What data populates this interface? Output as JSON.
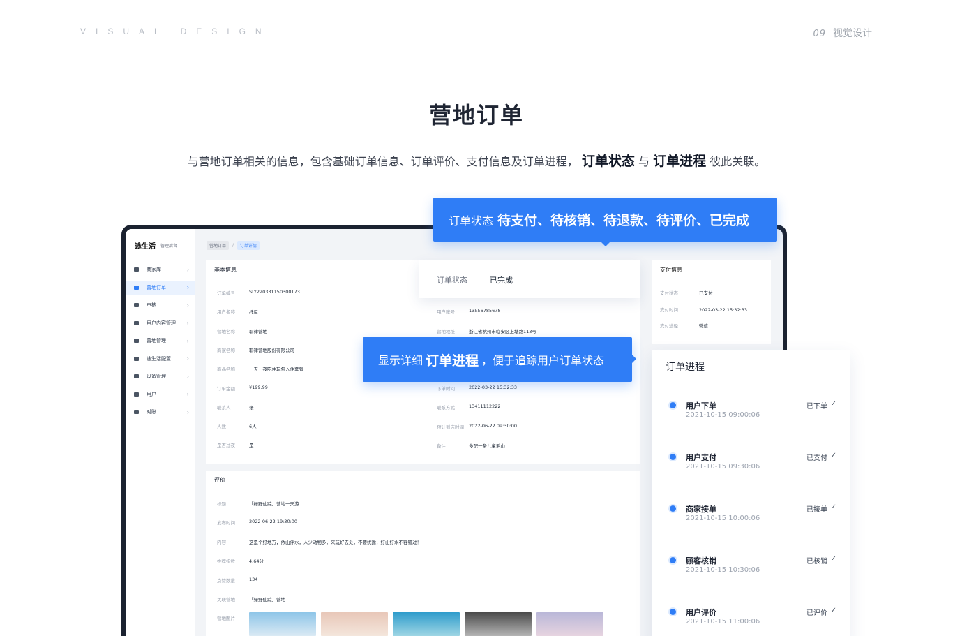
{
  "header": {
    "tagline": "VISUAL DESIGN",
    "page_number": "09",
    "section_name": "视觉设计"
  },
  "title": "营地订单",
  "subtitle": {
    "text_before": "与营地订单相关的信息，包含基础订单信息、订单评价、支付信息及订单进程，",
    "bold1": "订单状态",
    "middle": "与",
    "bold2": "订单进程",
    "text_after": "彼此关联。"
  },
  "callout_status": {
    "label": "订单状态",
    "values": "待支付、待核销、待退款、待评价、已完成"
  },
  "callout_progress": {
    "before": "显示详细",
    "bold": "订单进程",
    "after": "，便于追踪用户订单状态"
  },
  "app": {
    "brand": "途生活",
    "brand_sub": "管理后台",
    "sidebar": [
      {
        "label": "商家库",
        "active": false
      },
      {
        "label": "营地订单",
        "active": true
      },
      {
        "label": "审核",
        "active": false
      },
      {
        "label": "用户内容管理",
        "active": false
      },
      {
        "label": "营地管理",
        "active": false
      },
      {
        "label": "途生活配置",
        "active": false
      },
      {
        "label": "设备管理",
        "active": false
      },
      {
        "label": "用户",
        "active": false
      },
      {
        "label": "对账",
        "active": false
      }
    ],
    "breadcrumb": [
      "营地订单",
      "订单详情"
    ],
    "basic_info": {
      "title": "基本信息",
      "left": [
        {
          "k": "订单编号",
          "v": "SLY220331150300173"
        },
        {
          "k": "用户名称",
          "v": "托尼"
        },
        {
          "k": "营地名称",
          "v": "耶律营地"
        },
        {
          "k": "商家名称",
          "v": "耶律营地股份有限公司"
        },
        {
          "k": "商品名称",
          "v": "一天一夜吃住玩包入住套餐"
        },
        {
          "k": "订单金额",
          "v": "¥199.99"
        },
        {
          "k": "联系人",
          "v": "张"
        },
        {
          "k": "人数",
          "v": "6人"
        },
        {
          "k": "是否过夜",
          "v": "是"
        }
      ],
      "right": [
        {
          "k": "用户账号",
          "v": "13556785678"
        },
        {
          "k": "营地地址",
          "v": "浙江省杭州市临安区上塘路113号"
        },
        {
          "k": "下单时间",
          "v": "2022-03-22 15:32:33"
        },
        {
          "k": "联系方式",
          "v": "13411112222"
        },
        {
          "k": "预计到店时间",
          "v": "2022-06-22 09:30:00"
        },
        {
          "k": "备注",
          "v": "多配一条儿童毛巾"
        }
      ]
    },
    "status_card": {
      "k": "订单状态",
      "v": "已完成"
    },
    "pay_info": {
      "title": "支付信息",
      "rows": [
        {
          "k": "支付状态",
          "v": "已支付"
        },
        {
          "k": "支付时间",
          "v": "2022-03-22 15:32:33"
        },
        {
          "k": "支付途径",
          "v": "微信"
        }
      ]
    },
    "review": {
      "title": "评价",
      "rows": [
        {
          "k": "标题",
          "v": "「绿野仙踪」营地一天游"
        },
        {
          "k": "发布时间",
          "v": "2022-06-22 19:30:00"
        },
        {
          "k": "内容",
          "v": "这是个好地方，依山伴水，人少动物多，来玩好去处，不要犹豫，好山好水不容错过！"
        },
        {
          "k": "推荐指数",
          "v": "4.64分"
        },
        {
          "k": "点赞数量",
          "v": "134"
        },
        {
          "k": "关联营地",
          "v": "「绿野仙踪」营地"
        },
        {
          "k": "营地图片",
          "v": ""
        }
      ],
      "photos": [
        {
          "name": "sky-photo",
          "colors": [
            "#8ec5e8",
            "#dbeaf4"
          ]
        },
        {
          "name": "domes-photo",
          "colors": [
            "#e8c7b8",
            "#f4e6dc"
          ]
        },
        {
          "name": "beach-photo",
          "colors": [
            "#2f9ccc",
            "#9fd6e4"
          ]
        },
        {
          "name": "statue-photo",
          "colors": [
            "#4b4b4b",
            "#b5b5b5"
          ]
        },
        {
          "name": "clouds-photo",
          "colors": [
            "#b9b7d8",
            "#e7d4e0"
          ]
        }
      ]
    }
  },
  "progress": {
    "title": "订单进程",
    "steps": [
      {
        "name": "用户下单",
        "time": "2021-10-15 09:00:06",
        "status": "已下单"
      },
      {
        "name": "用户支付",
        "time": "2021-10-15 09:30:06",
        "status": "已支付"
      },
      {
        "name": "商家接单",
        "time": "2021-10-15 10:00:06",
        "status": "已接单"
      },
      {
        "name": "顾客核销",
        "time": "2021-10-15 10:30:06",
        "status": "已核销"
      },
      {
        "name": "用户评价",
        "time": "2021-10-15 11:00:06",
        "status": "已评价"
      }
    ]
  },
  "colors": {
    "accent": "#2f7df6",
    "frame": "#1b2230"
  }
}
